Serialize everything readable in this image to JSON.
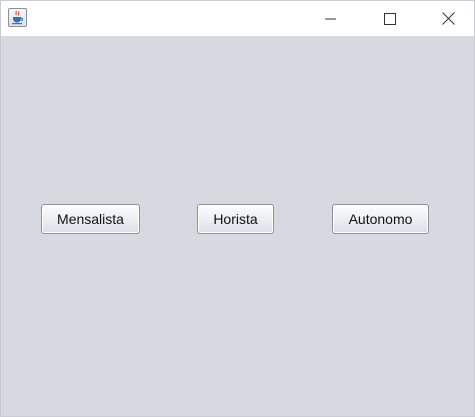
{
  "window": {
    "icon": "java-cup-icon",
    "controls": {
      "minimize": "minimize-icon",
      "maximize": "maximize-icon",
      "close": "close-icon"
    }
  },
  "buttons": {
    "mensalista": "Mensalista",
    "horista": "Horista",
    "autonomo": "Autonomo"
  },
  "colors": {
    "content_background": "#d6d9e0",
    "titlebar_background": "#ffffff"
  }
}
